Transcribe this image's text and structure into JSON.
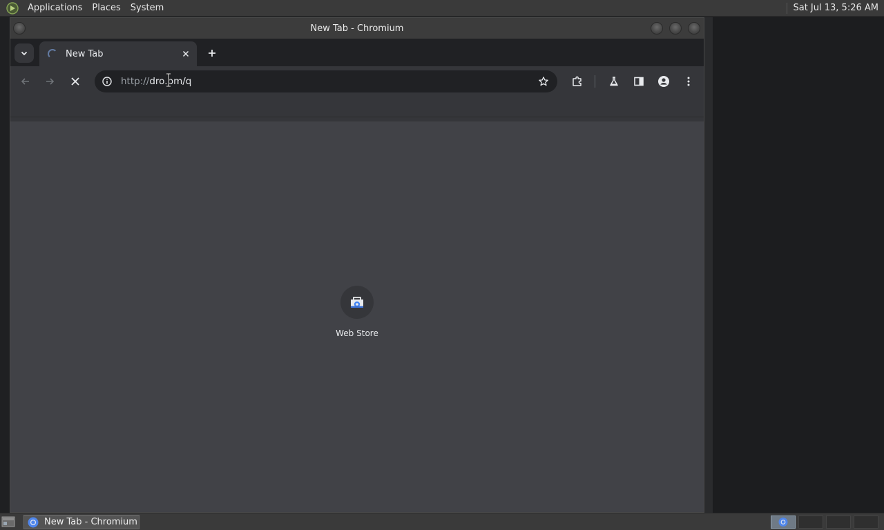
{
  "panel": {
    "menus": [
      "Applications",
      "Places",
      "System"
    ],
    "clock": "Sat Jul 13,  5:26 AM"
  },
  "window": {
    "title": "New Tab - Chromium"
  },
  "tabs": [
    {
      "title": "New Tab",
      "loading": true
    }
  ],
  "omnibox": {
    "url_scheme": "http://",
    "url_rest": "dro.pm/q"
  },
  "content": {
    "background": "#414247",
    "shortcuts": [
      {
        "label": "Web Store",
        "icon": "web-store-icon"
      }
    ]
  },
  "taskbar": {
    "task_label": "New Tab - Chromium",
    "workspaces": 4,
    "active_workspace": 1
  },
  "colors": {
    "panel": "#3a3a3a",
    "tabstrip": "#202124",
    "toolbar": "#35363a",
    "accent": "#8ab4f8"
  }
}
